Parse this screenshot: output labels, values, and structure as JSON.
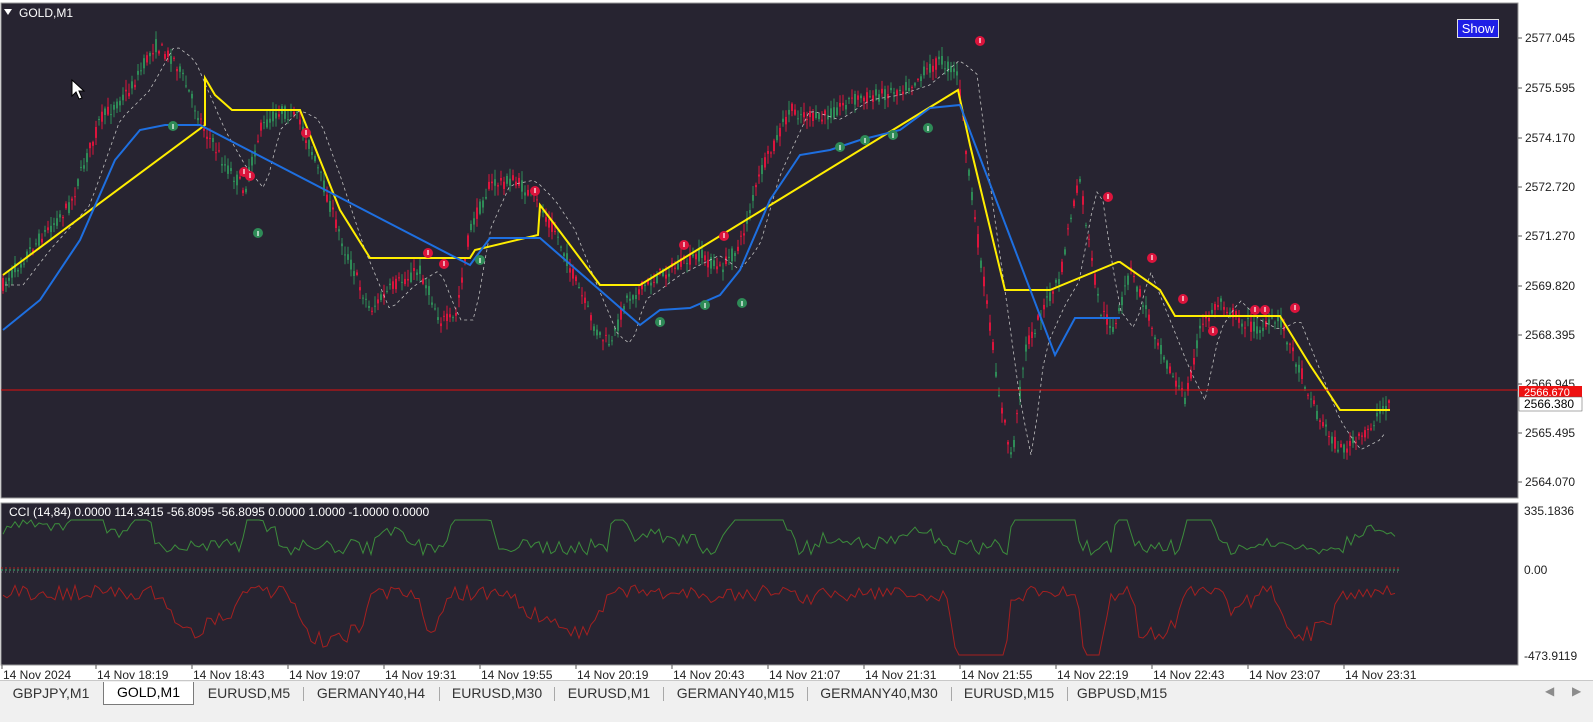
{
  "window": {
    "symbol_label": "GOLD,M1"
  },
  "main_chart": {
    "price_axis": [
      "2577.045",
      "2575.595",
      "2574.170",
      "2572.720",
      "2571.270",
      "2569.820",
      "2568.395",
      "2566.945",
      "2565.495",
      "2564.070"
    ],
    "current_price_label": "2566.380",
    "ask_price_label": "2566.670",
    "show_button_label": "Show"
  },
  "indicator": {
    "header": "CCI (14,84) 0.0000 114.3415 -56.8095 -56.8095 0.0000 1.0000 -1.0000 0.0000",
    "axis": [
      "335.1836",
      "0.00",
      "-473.9119"
    ]
  },
  "time_axis": [
    "14 Nov 2024",
    "14 Nov 18:19",
    "14 Nov 18:43",
    "14 Nov 19:07",
    "14 Nov 19:31",
    "14 Nov 19:55",
    "14 Nov 20:19",
    "14 Nov 20:43",
    "14 Nov 21:07",
    "14 Nov 21:31",
    "14 Nov 21:55",
    "14 Nov 22:19",
    "14 Nov 22:43",
    "14 Nov 23:07",
    "14 Nov 23:31"
  ],
  "tabs": [
    {
      "label": "GBPJPY,M1",
      "active": false
    },
    {
      "label": "GOLD,M1",
      "active": true
    },
    {
      "label": "EURUSD,M5",
      "active": false
    },
    {
      "label": "GERMANY40,H4",
      "active": false
    },
    {
      "label": "EURUSD,M30",
      "active": false
    },
    {
      "label": "EURUSD,M1",
      "active": false
    },
    {
      "label": "GERMANY40,M15",
      "active": false
    },
    {
      "label": "GERMANY40,M30",
      "active": false
    },
    {
      "label": "EURUSD,M15",
      "active": false
    },
    {
      "label": "GBPUSD,M15",
      "active": false
    }
  ],
  "colors": {
    "background": "#272431",
    "bull": "#2e8b57",
    "bear": "#dc143c",
    "yellow_line": "#ffee00",
    "blue_line": "#1e6fe0",
    "price_line": "#e01010",
    "cci_green": "#3c8c3c",
    "cci_red": "#a52020"
  }
}
